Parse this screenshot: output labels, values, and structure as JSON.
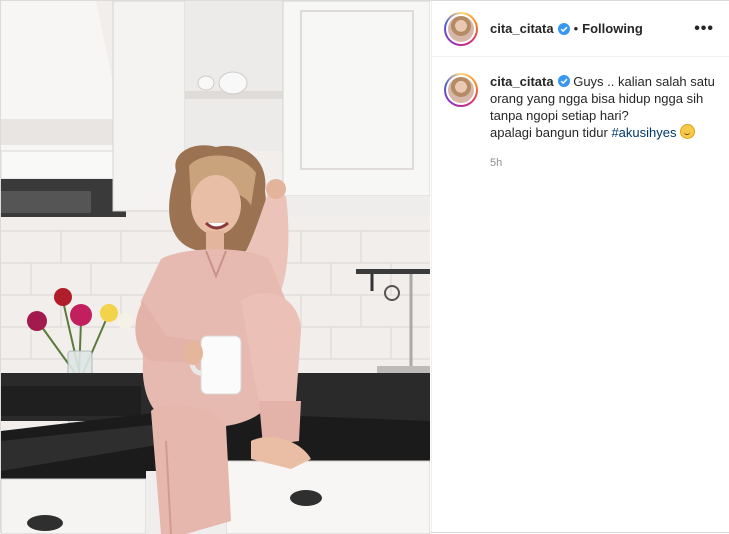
{
  "post": {
    "username": "cita_citata",
    "separator": "•",
    "follow_status": "Following",
    "more_label": "•••"
  },
  "caption": {
    "username": "cita_citata",
    "text_line1": "Guys .. kalian salah satu orang yang ngga bisa hidup ngga sih tanpa ngopi setiap hari?",
    "text_line2": "apalagi bangun tidur",
    "hashtag": "#akusihyes",
    "emoji": "grinning-face-sweat",
    "time": "5h"
  },
  "icons": {
    "verified": "verified-badge-icon",
    "more": "more-options-icon"
  },
  "colors": {
    "verified_blue": "#3897f0",
    "hashtag": "#00376b",
    "meta_gray": "#8e8e8e"
  }
}
